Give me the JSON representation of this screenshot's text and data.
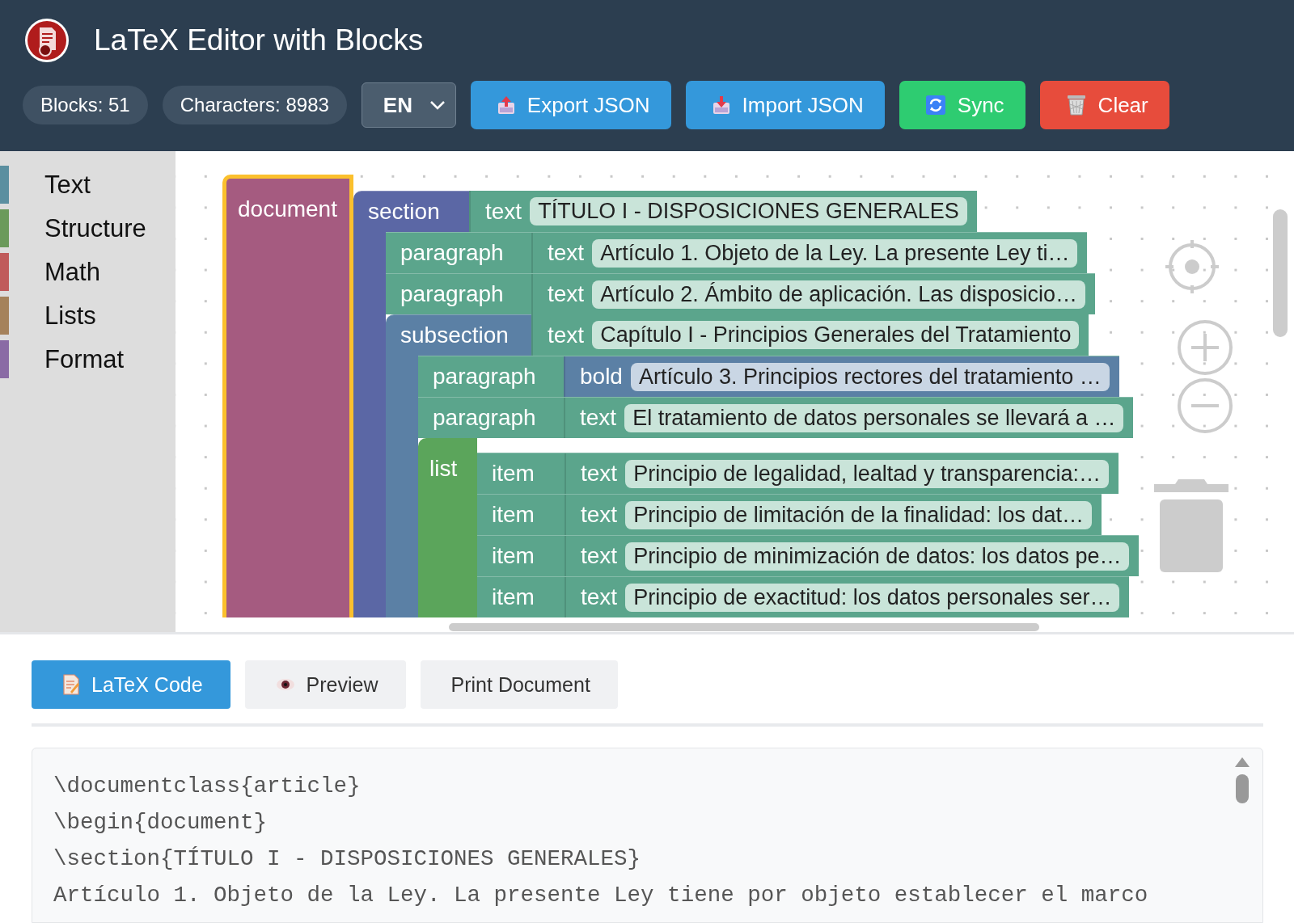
{
  "header": {
    "title": "LaTeX Editor with Blocks",
    "stats": [
      "Blocks: 51",
      "Characters: 8983"
    ],
    "language": "EN",
    "buttons": [
      {
        "label": "Export JSON",
        "kind": "export"
      },
      {
        "label": "Import JSON",
        "kind": "import"
      },
      {
        "label": "Sync",
        "kind": "sync"
      },
      {
        "label": "Clear",
        "kind": "clear"
      }
    ]
  },
  "toolbox": {
    "categories": [
      {
        "label": "Text",
        "color": "#5b8fa0"
      },
      {
        "label": "Structure",
        "color": "#6b9a5b"
      },
      {
        "label": "Math",
        "color": "#c05b5b"
      },
      {
        "label": "Lists",
        "color": "#a5825b"
      },
      {
        "label": "Format",
        "color": "#8a6ba5"
      }
    ]
  },
  "workspace": {
    "blocks": [
      {
        "kind": "document",
        "label": "document",
        "selected": true,
        "children": [
          {
            "kind": "section",
            "label": "section",
            "selected": false,
            "input": {
              "kind": "text",
              "label": "text",
              "value": "TÍTULO I - DISPOSICIONES GENERALES"
            },
            "children": [
              {
                "kind": "paragraph",
                "label": "paragraph",
                "selected": false,
                "input": {
                  "kind": "text",
                  "label": "text",
                  "value": "Artículo 1. Objeto de la Ley. La presente Ley ti…"
                }
              },
              {
                "kind": "paragraph",
                "label": "paragraph",
                "selected": false,
                "input": {
                  "kind": "text",
                  "label": "text",
                  "value": "Artículo 2. Ámbito de aplicación. Las disposicio…"
                }
              },
              {
                "kind": "subsection",
                "label": "subsection",
                "selected": false,
                "input": {
                  "kind": "text",
                  "label": "text",
                  "value": "Capítulo I - Principios Generales del Tratamiento"
                },
                "children": [
                  {
                    "kind": "paragraph",
                    "label": "paragraph",
                    "selected": false,
                    "input": {
                      "kind": "bold",
                      "label": "bold",
                      "value": "Artículo 3. Principios rectores del tratamiento …"
                    }
                  },
                  {
                    "kind": "paragraph",
                    "label": "paragraph",
                    "selected": false,
                    "input": {
                      "kind": "text",
                      "label": "text",
                      "value": "El tratamiento de datos personales se llevará a …"
                    }
                  },
                  {
                    "kind": "list",
                    "label": "list",
                    "selected": false,
                    "children": [
                      {
                        "kind": "item",
                        "label": "item",
                        "selected": false,
                        "input": {
                          "kind": "text",
                          "label": "text",
                          "value": "Principio de legalidad, lealtad y transparencia:…"
                        }
                      },
                      {
                        "kind": "item",
                        "label": "item",
                        "selected": false,
                        "input": {
                          "kind": "text",
                          "label": "text",
                          "value": "Principio de limitación de la finalidad: los dat…"
                        }
                      },
                      {
                        "kind": "item",
                        "label": "item",
                        "selected": false,
                        "input": {
                          "kind": "text",
                          "label": "text",
                          "value": "Principio de minimización de datos: los datos pe…"
                        }
                      },
                      {
                        "kind": "item",
                        "label": "item",
                        "selected": false,
                        "input": {
                          "kind": "text",
                          "label": "text",
                          "value": "Principio de exactitud: los datos personales ser…"
                        }
                      }
                    ]
                  }
                ]
              }
            ]
          }
        ]
      }
    ]
  },
  "output": {
    "tabs": [
      {
        "label": "LaTeX Code",
        "selected": true
      },
      {
        "label": "Preview",
        "selected": false
      },
      {
        "label": "Print Document",
        "selected": false
      }
    ],
    "code_lines": [
      "\\documentclass{article}",
      "\\begin{document}",
      "\\section{TÍTULO I - DISPOSICIONES GENERALES}",
      "Artículo 1. Objeto de la Ley. La presente Ley tiene por objeto establecer el marco"
    ]
  }
}
